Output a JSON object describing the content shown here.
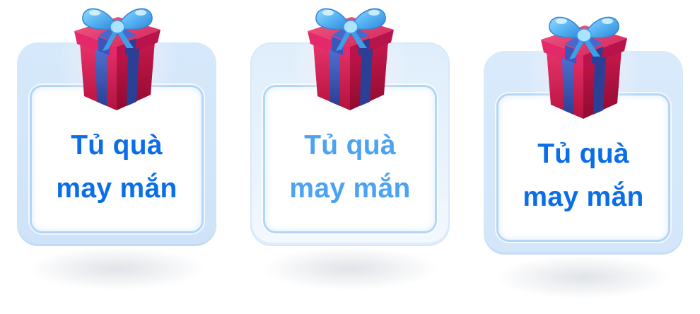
{
  "cards": [
    {
      "title_line1": "Tủ quà",
      "title_line2": "may mắn",
      "icon": "gift-box-icon"
    },
    {
      "title_line1": "Tủ quà",
      "title_line2": "may mắn",
      "icon": "gift-box-icon"
    },
    {
      "title_line1": "Tủ quà",
      "title_line2": "may mắn",
      "icon": "gift-box-icon"
    }
  ],
  "colors": {
    "text_primary": "#0b6ee8",
    "text_muted": "#4ba3f2",
    "card_bg": "#d6e9fb",
    "card_inner_border": "#b3d6f6",
    "gift_box": "#d81e5b",
    "gift_ribbon": "#3b5bb5",
    "gift_bow": "#58b6f3"
  }
}
